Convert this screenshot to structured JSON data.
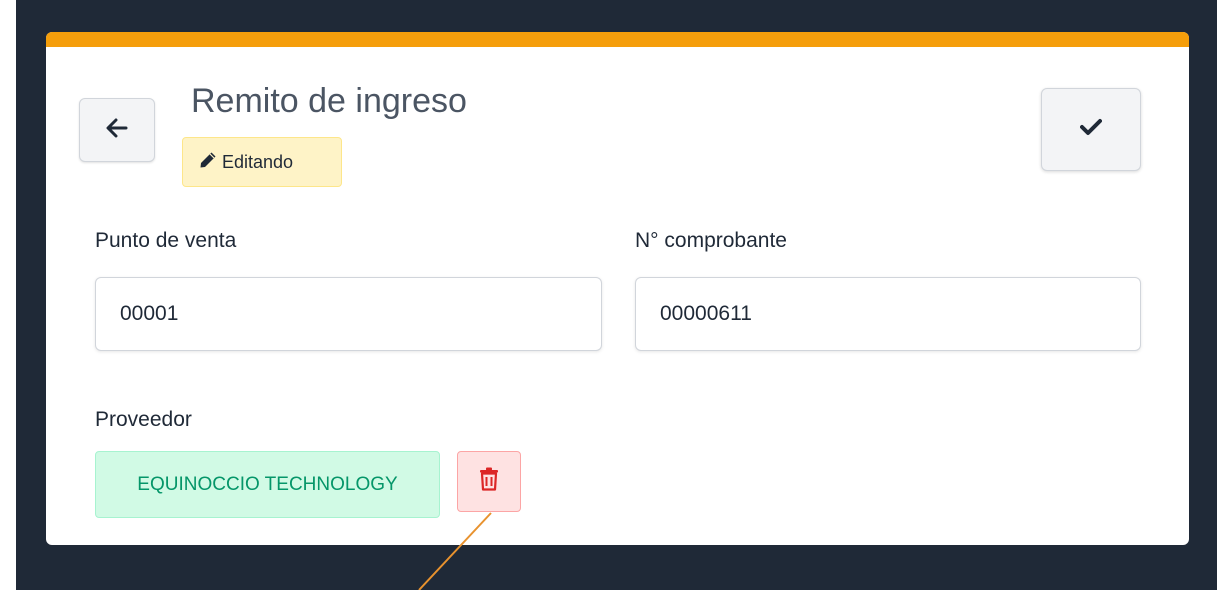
{
  "header": {
    "title": "Remito de ingreso",
    "status_badge": "Editando",
    "back_icon": "arrow-left-icon",
    "confirm_icon": "check-icon",
    "badge_icon": "pencil-icon"
  },
  "form": {
    "punto_venta": {
      "label": "Punto de venta",
      "value": "00001"
    },
    "comprobante": {
      "label": "N° comprobante",
      "value": "00000611"
    },
    "proveedor": {
      "label": "Proveedor",
      "selected": "EQUINOCCIO TECHNOLOGY",
      "delete_icon": "trash-icon"
    }
  },
  "colors": {
    "accent_bar": "#f59e0b",
    "backdrop": "#1f2937",
    "badge_bg": "#fef3c7",
    "chip_bg": "#d1fae5",
    "chip_text": "#059669",
    "delete_bg": "#fee2e2",
    "delete_icon": "#dc2626",
    "annotation_line": "#e8922e"
  }
}
